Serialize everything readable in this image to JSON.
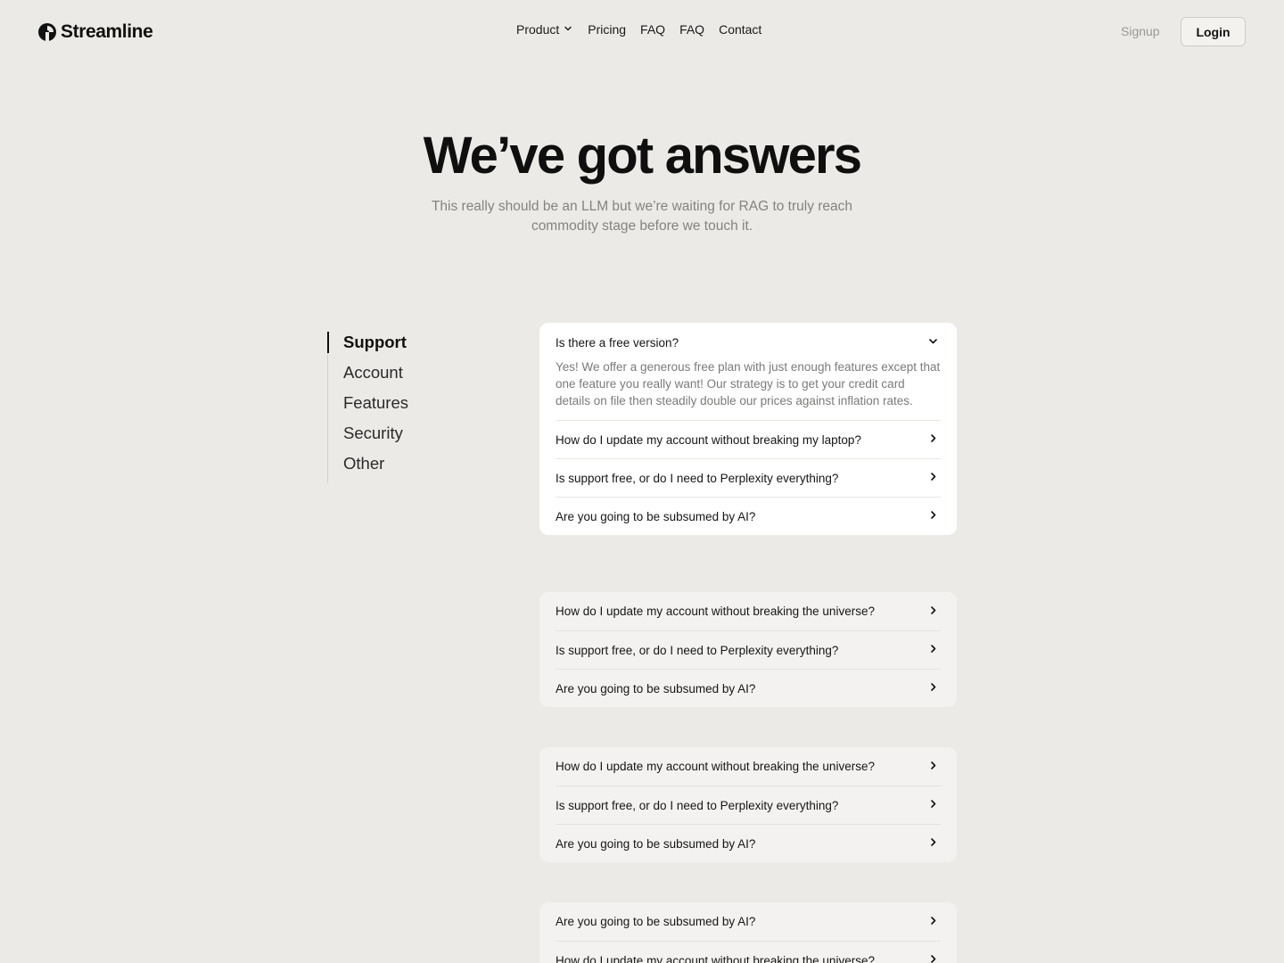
{
  "brand": {
    "name": "Streamline",
    "logo_icon": "streamline-logo-icon"
  },
  "nav": {
    "items": [
      {
        "label": "Product",
        "has_dropdown": true
      },
      {
        "label": "Pricing"
      },
      {
        "label": "FAQ"
      },
      {
        "label": "FAQ"
      },
      {
        "label": "Contact"
      }
    ],
    "signup_label": "Signup",
    "login_label": "Login"
  },
  "hero": {
    "title": "We’ve got answers",
    "subtitle": "This really should be an LLM but we’re waiting for RAG to truly reach commodity stage before we touch it."
  },
  "categories": [
    {
      "label": "Support",
      "active": true
    },
    {
      "label": "Account"
    },
    {
      "label": "Features"
    },
    {
      "label": "Security"
    },
    {
      "label": "Other"
    }
  ],
  "faq_groups": [
    {
      "open": {
        "question": "Is there a free version?",
        "answer": "Yes! We offer a generous free plan with just enough features except that one feature you really want! Our strategy is to get your credit card details on file then steadily double our prices against inflation rates."
      },
      "items": [
        "How do I update my account without breaking my laptop?",
        "Is support free, or do I need to Perplexity everything?",
        "Are you going to be subsumed by AI?"
      ]
    },
    {
      "items": [
        "How do I update my account without breaking the universe?",
        "Is support free, or do I need to Perplexity everything?",
        "Are you going to be subsumed by AI?"
      ]
    },
    {
      "items": [
        "How do I update my account without breaking the universe?",
        "Is support free, or do I need to Perplexity everything?",
        "Are you going to be subsumed by AI?"
      ]
    },
    {
      "items": [
        "Are you going to be subsumed by AI?",
        "How do I update my account without breaking the universe?"
      ]
    }
  ],
  "colors": {
    "background": "#eceae6",
    "card_open": "#ffffff",
    "card_closed": "#f3f2f0",
    "text": "#141414",
    "muted": "#858380"
  }
}
